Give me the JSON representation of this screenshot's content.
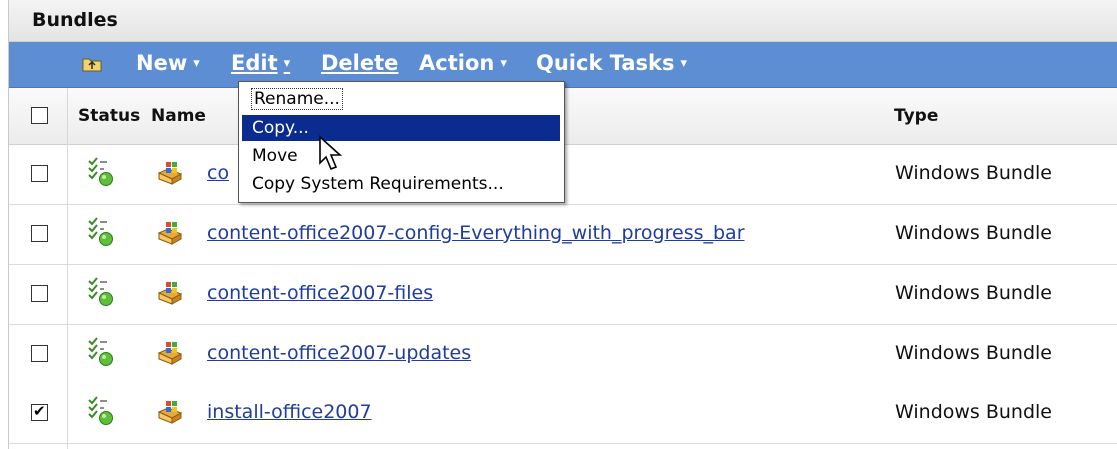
{
  "panel": {
    "title": "Bundles"
  },
  "toolbar": {
    "new_label": "New",
    "edit_label": "Edit",
    "delete_label": "Delete",
    "action_label": "Action",
    "quick_tasks_label": "Quick Tasks",
    "caret": "▾",
    "folder_icon": "folder-up-icon",
    "background": "#5d8ed4"
  },
  "table": {
    "headers": {
      "status": "Status",
      "name": "Name",
      "type": "Type"
    },
    "rows": [
      {
        "name": "co",
        "type": "Windows Bundle",
        "checked": false
      },
      {
        "name": "content-office2007-config-Everything_with_progress_bar",
        "type": "Windows Bundle",
        "checked": false
      },
      {
        "name": "content-office2007-files",
        "type": "Windows Bundle",
        "checked": false
      },
      {
        "name": "content-office2007-updates",
        "type": "Windows Bundle",
        "checked": false
      },
      {
        "name": "install-office2007",
        "type": "Windows Bundle",
        "checked": true
      }
    ]
  },
  "edit_menu": {
    "items": [
      {
        "label": "Rename..."
      },
      {
        "label": "Copy..."
      },
      {
        "label": "Move"
      },
      {
        "label": "Copy System Requirements..."
      }
    ],
    "highlight_color": "#0a2c8e"
  },
  "colors": {
    "link": "#1f3c9e"
  }
}
